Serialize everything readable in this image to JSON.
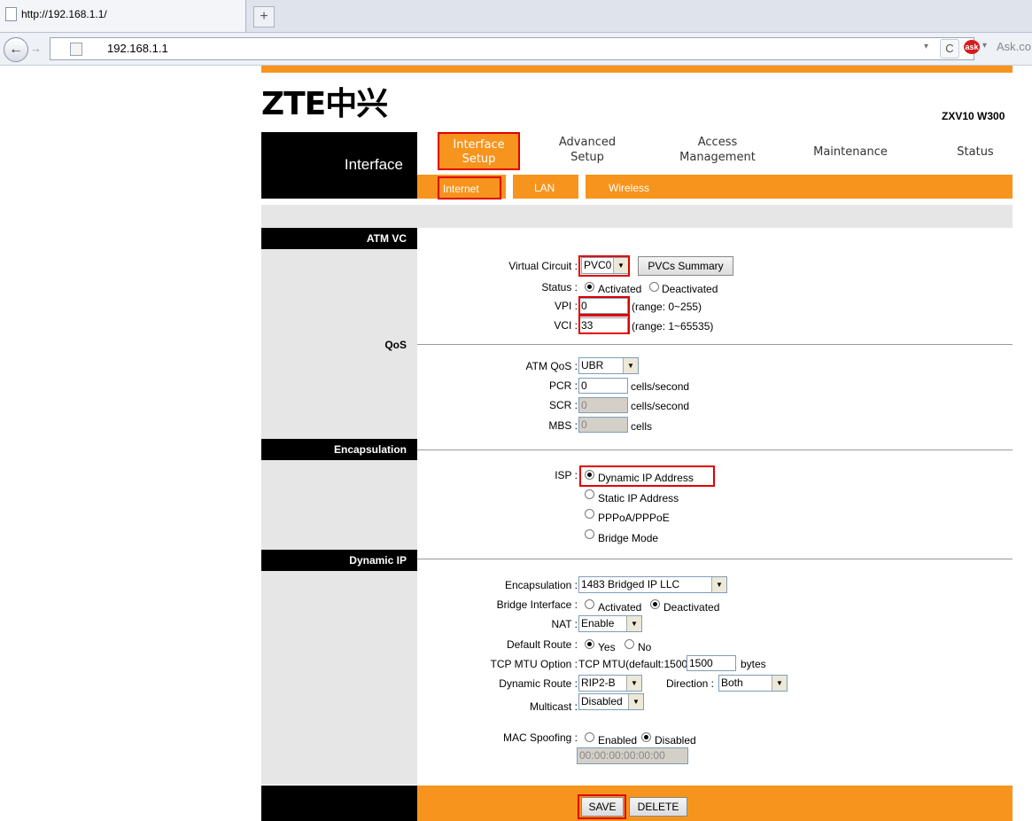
{
  "browser": {
    "tab_title": "http://192.168.1.1/",
    "new_tab": "+",
    "back": "←",
    "forward": "→",
    "url": "192.168.1.1",
    "url_dropdown": "▾",
    "reload": "C",
    "ask_dropdown": "▾",
    "ask_search": "Ask.co"
  },
  "header": {
    "logo": "ZTE中兴",
    "model": "ZXV10 W300"
  },
  "nav": {
    "section_label": "Interface",
    "menu": [
      {
        "line1": "Interface",
        "line2": "Setup"
      },
      {
        "line1": "Advanced",
        "line2": "Setup"
      },
      {
        "line1": "Access",
        "line2": "Management"
      },
      {
        "line1": "Maintenance",
        "line2": ""
      },
      {
        "line1": "Status",
        "line2": ""
      }
    ],
    "submenu": [
      "Internet",
      "LAN",
      "Wireless"
    ]
  },
  "sections": {
    "atm_vc": "ATM VC",
    "qos": "QoS",
    "encapsulation": "Encapsulation",
    "dynamic_ip": "Dynamic IP"
  },
  "atm": {
    "virtual_circuit_label": "Virtual Circuit :",
    "virtual_circuit_value": "PVC0",
    "pvcs_summary": "PVCs Summary",
    "status_label": "Status :",
    "activated": "Activated",
    "deactivated": "Deactivated",
    "vpi_label": "VPI :",
    "vpi_value": "0",
    "vpi_range": "(range: 0~255)",
    "vci_label": "VCI :",
    "vci_value": "33",
    "vci_range": "(range: 1~65535)"
  },
  "qos": {
    "atm_qos_label": "ATM QoS :",
    "atm_qos_value": "UBR",
    "pcr_label": "PCR :",
    "pcr_value": "0",
    "pcr_unit": "cells/second",
    "scr_label": "SCR :",
    "scr_value": "0",
    "scr_unit": "cells/second",
    "mbs_label": "MBS :",
    "mbs_value": "0",
    "mbs_unit": "cells"
  },
  "isp": {
    "label": "ISP :",
    "options": [
      "Dynamic IP Address",
      "Static IP Address",
      "PPPoA/PPPoE",
      "Bridge Mode"
    ]
  },
  "dynamic": {
    "encapsulation_label": "Encapsulation :",
    "encapsulation_value": "1483 Bridged IP LLC",
    "bridge_label": "Bridge Interface :",
    "bridge_activated": "Activated",
    "bridge_deactivated": "Deactivated",
    "nat_label": "NAT :",
    "nat_value": "Enable",
    "default_route_label": "Default Route :",
    "yes": "Yes",
    "no": "No",
    "mtu_label": "TCP MTU Option :",
    "mtu_text": "TCP MTU(default:1500)",
    "mtu_value": "1500",
    "mtu_unit": "bytes",
    "dynamic_route_label": "Dynamic Route :",
    "dynamic_route_value": "RIP2-B",
    "direction_label": "Direction :",
    "direction_value": "Both",
    "multicast_label": "Multicast :",
    "multicast_value": "Disabled",
    "mac_label": "MAC Spoofing :",
    "mac_enabled": "Enabled",
    "mac_disabled": "Disabled",
    "mac_value": "00:00:00:00:00:00"
  },
  "footer": {
    "save": "SAVE",
    "delete": "DELETE"
  },
  "colors": {
    "accent": "#f7941d",
    "highlight": "#e00000"
  }
}
